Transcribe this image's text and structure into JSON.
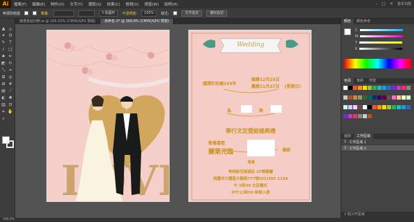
{
  "app": {
    "logo": "Ai",
    "workspace": "基本功能"
  },
  "menus": [
    "檔案(F)",
    "編輯(E)",
    "物件(O)",
    "文字(T)",
    "選取(S)",
    "效果(C)",
    "檢視(V)",
    "視窗(W)",
    "說明(H)"
  ],
  "control": {
    "selection": "無選取範圍",
    "stroke_label": "筆畫:",
    "brush": "3 點圓形",
    "opacity_label": "不透明度:",
    "opacity": "100%",
    "style_label": "樣式:",
    "doc_setup": "文件設定",
    "prefs": "偏好設定"
  },
  "tabs": [
    {
      "label": "婚禮喜帖印刷.ai @ 105.33% (CMYK/GPU 預視)",
      "active": false
    },
    {
      "label": "未命名-2* @ 366.8% (CMYK/GPU 預視)",
      "active": true
    }
  ],
  "wedding": {
    "banner": "Wedding",
    "date_line1": "國曆12月25日",
    "date_line2": "農曆11月27日",
    "year": "謹擇於民國105年",
    "weekday": "(星期日)",
    "parents_label": "為",
    "name_label": "與",
    "ceremony": "舉行文定暨結婚典禮",
    "invite_line1": "敬備喜筵",
    "invite_line2": "闔第光臨",
    "bow": "鞠躬",
    "respect": "敬邀",
    "venue": "林桃新空城酒店  2F晴春廳",
    "address": "桃園市大園區大觀路777號(03)385  1188",
    "time1": "午 5時30 文定儀式",
    "time2": "中午12時30 恭候入席",
    "love": "LOVE"
  },
  "color_panel": {
    "tabs": [
      "顏色",
      "顏色參考"
    ],
    "channels": [
      "C",
      "M",
      "Y",
      "K"
    ]
  },
  "swatch_panel": {
    "tabs": [
      "色票",
      "筆刷",
      "符號"
    ]
  },
  "layers_panel": {
    "tabs": [
      "圖層",
      "工作區域"
    ],
    "rows": [
      {
        "num": "1",
        "name": "工作區域 1",
        "selected": false
      },
      {
        "num": "2",
        "name": "工作區域 2",
        "selected": true
      }
    ],
    "footer": "2 個工作區域"
  },
  "status": {
    "zoom": "366.8%"
  }
}
